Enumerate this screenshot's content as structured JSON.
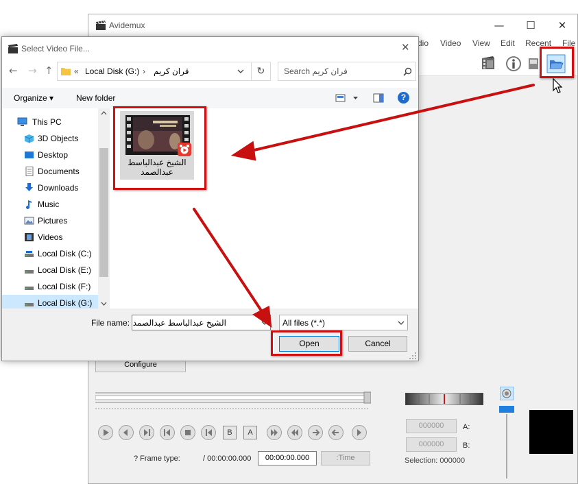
{
  "avidemux": {
    "title": "Avidemux",
    "controls": {
      "minimize": "—",
      "maximize": "☐",
      "close": "✕"
    },
    "menu": [
      "File",
      "Recent",
      "Edit",
      "View",
      "Video",
      "dio"
    ],
    "configure_label": "Configure",
    "frame_type_label": "? Frame type:",
    "total_time": "/ 00:00:00.000",
    "current_time": "00:00:00.000",
    "time_button": ":Time",
    "marker_a_value": "000000",
    "marker_a_label": "A:",
    "marker_b_value": "000000",
    "marker_b_label": "B:",
    "selection": "Selection: 000000",
    "segment_buttons": [
      "B",
      "A"
    ],
    "icons": [
      "clapper-icon",
      "open-folder-icon",
      "info-icon",
      "film-icon"
    ]
  },
  "dialog": {
    "title": "Select Video File...",
    "close": "✕",
    "back": "←",
    "forward": "→",
    "up": "↑",
    "breadcrumb": {
      "chevron": "«",
      "drive": "Local Disk (G:)",
      "separator": "›",
      "folder": "قران كريم"
    },
    "refresh": "↻",
    "search_placeholder": "Search قران كريم",
    "organize": "Organize ▾",
    "new_folder": "New folder",
    "help": "?",
    "nav_items": [
      {
        "label": "This PC",
        "icon": "pc"
      },
      {
        "label": "3D Objects",
        "icon": "cube"
      },
      {
        "label": "Desktop",
        "icon": "desktop"
      },
      {
        "label": "Documents",
        "icon": "doc"
      },
      {
        "label": "Downloads",
        "icon": "download"
      },
      {
        "label": "Music",
        "icon": "music"
      },
      {
        "label": "Pictures",
        "icon": "picture"
      },
      {
        "label": "Videos",
        "icon": "video"
      },
      {
        "label": "Local Disk (C:)",
        "icon": "drive"
      },
      {
        "label": "Local Disk (E:)",
        "icon": "drive"
      },
      {
        "label": "Local Disk (F:)",
        "icon": "drive"
      },
      {
        "label": "Local Disk (G:)",
        "icon": "drive",
        "selected": true
      }
    ],
    "file": {
      "name_line1": "الشيخ عبدالباسط",
      "name_line2": "عبدالصمد"
    },
    "file_name_label": "File name:",
    "file_name_value": "الشيخ عبدالباسط عبدالصمد",
    "file_type": "All files (*.*)",
    "open_label": "Open",
    "cancel_label": "Cancel"
  },
  "colors": {
    "highlight": "#d01010",
    "accent": "#0078d7",
    "selection": "#cce8ff"
  }
}
